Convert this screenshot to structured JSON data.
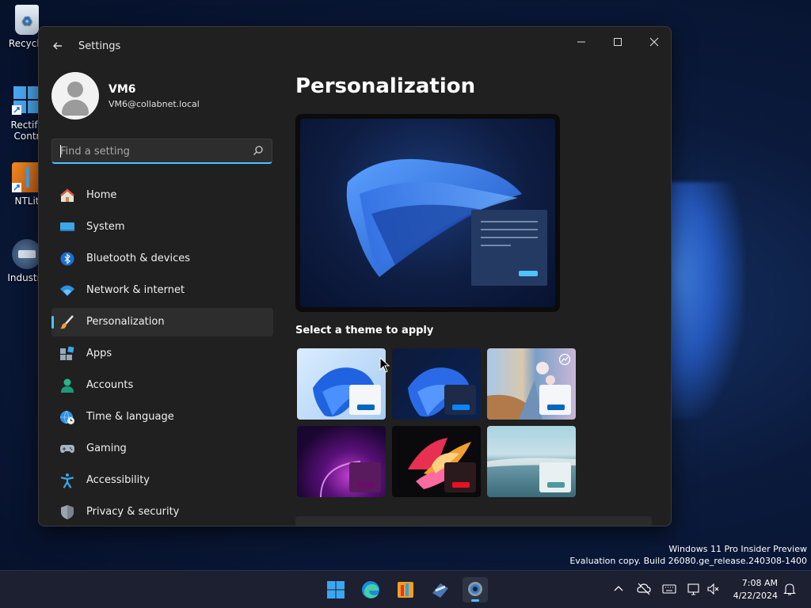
{
  "desktop": {
    "icons": [
      {
        "label": "Recycle"
      },
      {
        "label": "Rectify"
      },
      {
        "label": "Contr"
      },
      {
        "label": "NTLit"
      },
      {
        "label": "Industry"
      }
    ]
  },
  "window": {
    "title": "Settings",
    "controls": {
      "minimize": "—",
      "maximize": "☐",
      "close": "✕"
    }
  },
  "profile": {
    "name": "VM6",
    "email": "VM6@collabnet.local"
  },
  "search": {
    "placeholder": "Find a setting"
  },
  "nav": {
    "items": [
      {
        "label": "Home",
        "icon": "home-icon"
      },
      {
        "label": "System",
        "icon": "system-icon"
      },
      {
        "label": "Bluetooth & devices",
        "icon": "bluetooth-icon"
      },
      {
        "label": "Network & internet",
        "icon": "wifi-icon"
      },
      {
        "label": "Personalization",
        "icon": "brush-icon",
        "active": true
      },
      {
        "label": "Apps",
        "icon": "apps-icon"
      },
      {
        "label": "Accounts",
        "icon": "accounts-icon"
      },
      {
        "label": "Time & language",
        "icon": "globe-clock-icon"
      },
      {
        "label": "Gaming",
        "icon": "gamepad-icon"
      },
      {
        "label": "Accessibility",
        "icon": "accessibility-icon"
      },
      {
        "label": "Privacy & security",
        "icon": "shield-icon"
      }
    ]
  },
  "content": {
    "heading": "Personalization",
    "themes_label": "Select a theme to apply",
    "themes": [
      {
        "name": "windows-light",
        "accent": "#0067c0"
      },
      {
        "name": "windows-dark",
        "accent": "#0a84ff"
      },
      {
        "name": "spotlight",
        "accent": "#0067c0"
      },
      {
        "name": "glow",
        "accent": "#6a0d6a"
      },
      {
        "name": "captured-motion",
        "accent": "#e81123"
      },
      {
        "name": "flow",
        "accent": "#4a9aa0"
      }
    ]
  },
  "watermark": {
    "line1": "Windows 11 Pro Insider Preview",
    "line2": "Evaluation copy. Build 26080.ge_release.240308-1400"
  },
  "taskbar": {
    "apps": [
      "start-icon",
      "edge-icon",
      "app-icon",
      "app-icon-2",
      "settings-icon"
    ],
    "time": "7:08 AM",
    "date": "4/22/2024"
  },
  "colors": {
    "accent": "#4cc2ff",
    "window_bg": "#202020",
    "nav_active_bg": "#2d2d2d"
  }
}
